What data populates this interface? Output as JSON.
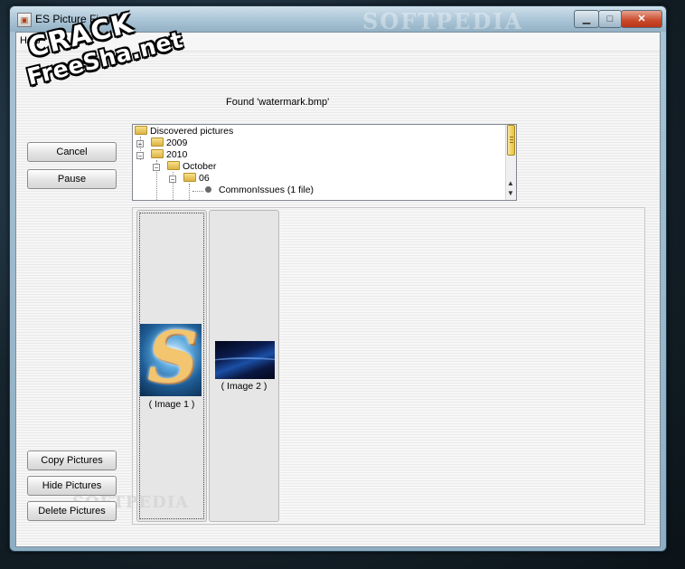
{
  "window": {
    "title": "ES Picture Finder",
    "minimize_glyph": "▁",
    "maximize_glyph": "□",
    "close_glyph": "✕"
  },
  "menu": {
    "help_label": "Help"
  },
  "status": {
    "text": "Found 'watermark.bmp'"
  },
  "buttons": {
    "cancel": "Cancel",
    "pause": "Pause",
    "copy": "Copy Pictures",
    "hide": "Hide Pictures",
    "delete": "Delete Pictures"
  },
  "tree": {
    "root": "Discovered pictures",
    "y2009": "2009",
    "y2010": "2010",
    "month": "October",
    "day": "06",
    "leaf": "CommonIssues (1 file)",
    "expanded_glyph": "−",
    "collapsed_glyph": "+"
  },
  "gallery": {
    "images": [
      {
        "label": "( Image 1 )"
      },
      {
        "label": "( Image 2 )"
      }
    ],
    "image1_glyph": "S"
  },
  "watermarks": {
    "crack": "CRACK",
    "site": "FreeSha.net",
    "softpedia": "SOFTPEDIA"
  },
  "icons": {
    "app": "app-icon",
    "folder": "folder-icon",
    "leaf": "bullet-icon"
  }
}
